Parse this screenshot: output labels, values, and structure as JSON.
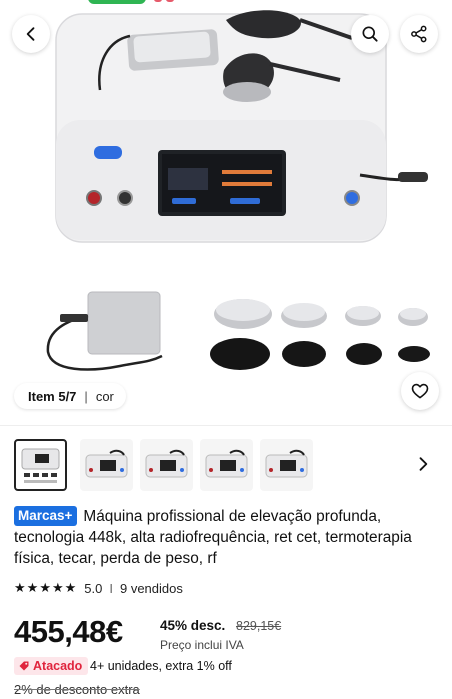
{
  "gallery": {
    "counter": "Item 5/7",
    "separator": "|",
    "option_label": "cor"
  },
  "product": {
    "brand_badge": "Marcas+",
    "title": "Máquina profissional de elevação profunda, tecnologia 448k, alta radiofrequência, ret cet, termoterapia física, tecar, perda de peso, rf",
    "rating": "5.0",
    "rating_separator": "I",
    "sold": "9 vendidos",
    "price": "455,48€",
    "discount": "45% desc.",
    "old_price": "829,15€",
    "tax_note": "Preço inclui IVA",
    "wholesale_badge": "Atacado",
    "wholesale_text": "4+ unidades, extra 1% off",
    "extra_discount": "2% de desconto extra"
  },
  "icons": {
    "back": "chevron-left-icon",
    "search": "search-icon",
    "share": "share-icon",
    "favorite": "heart-icon",
    "next": "chevron-right-icon",
    "star": "star-icon",
    "tag": "tag-icon"
  },
  "colors": {
    "brand_badge": "#1b6fe0",
    "wholesale": "#e0243d",
    "wholesale_bg": "#fde6ea"
  }
}
